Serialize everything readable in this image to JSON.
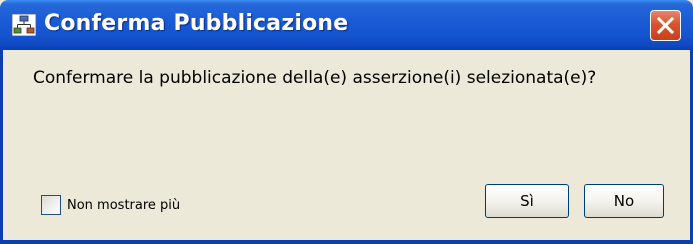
{
  "dialog": {
    "title": "Conferma Pubblicazione",
    "title_icon": "app-network-icon",
    "close_icon": "close-icon",
    "message": "Confermare la pubblicazione della(e) asserzione(i) selezionata(e)?",
    "checkbox": {
      "label": "Non mostrare più",
      "checked": false
    },
    "buttons": {
      "yes_label": "Sì",
      "no_label": "No"
    }
  },
  "colors": {
    "titlebar": "#1554d0",
    "body": "#ece9d8",
    "close_button": "#d9552e"
  }
}
